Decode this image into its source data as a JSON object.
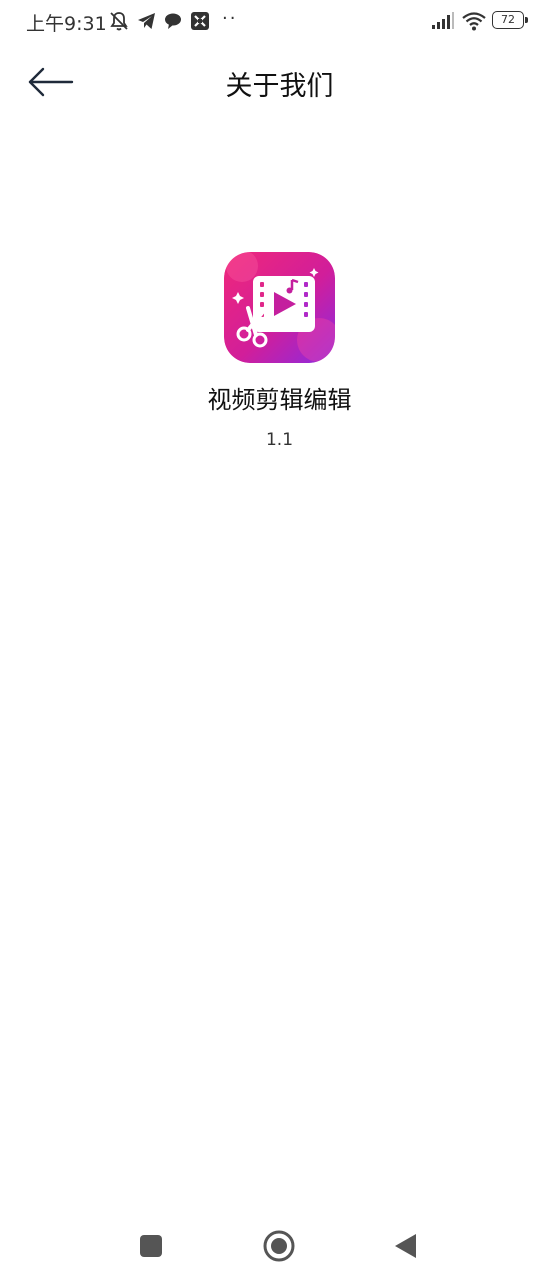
{
  "status_bar": {
    "time": "上午9:31",
    "dots": "··",
    "battery_level": "72",
    "icons": [
      "mute-bell-icon",
      "telegram-icon",
      "chat-bubble-icon",
      "app-notification-icon",
      "signal-icon",
      "wifi-icon",
      "battery-icon"
    ]
  },
  "header": {
    "title": "关于我们",
    "back_icon": "arrow-left-icon"
  },
  "app": {
    "name": "视频剪辑编辑",
    "version": "1.1",
    "icon": "video-editor-app-icon",
    "icon_colors": {
      "gradient_start": "#f0287a",
      "gradient_end": "#8a2be2"
    }
  },
  "nav_bar": {
    "icons": [
      "recent-apps-icon",
      "home-icon",
      "back-triangle-icon"
    ],
    "color": "#555555"
  }
}
